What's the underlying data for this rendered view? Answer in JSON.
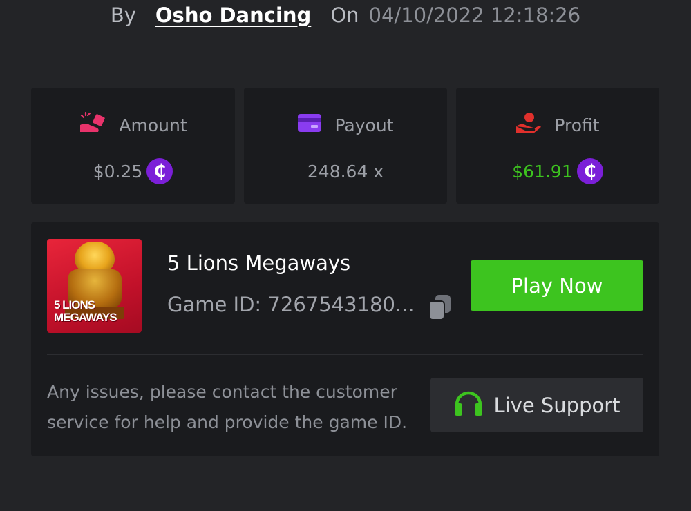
{
  "byline": {
    "by_label": "By",
    "author": "Osho Dancing",
    "on_label": "On",
    "datetime": "04/10/2022 12:18:26"
  },
  "stats": {
    "amount": {
      "label": "Amount",
      "value": "$0.25",
      "icon": "amount-hand-icon",
      "currency_icon": "coin-icon"
    },
    "payout": {
      "label": "Payout",
      "value": "248.64 x",
      "icon": "card-icon"
    },
    "profit": {
      "label": "Profit",
      "value": "$61.91",
      "icon": "profit-hand-icon",
      "currency_icon": "coin-icon"
    }
  },
  "coin_symbol": "₵",
  "game": {
    "title": "5 Lions Megaways",
    "game_id": "Game ID: 7267543180...",
    "thumbnail_line1": "5 LIONS",
    "thumbnail_line2": "MEGAWAYS",
    "play_label": "Play Now",
    "copy_icon": "copy-icon"
  },
  "support": {
    "help_text": "Any issues, please contact the customer service for help and provide the game ID.",
    "button_label": "Live Support",
    "icon": "headset-icon"
  },
  "colors": {
    "background": "#232427",
    "card": "#1a1b1e",
    "accent_green": "#3dc41f",
    "coin_purple": "#7b1fd8",
    "amount_pink": "#e8336b",
    "payout_purple": "#8a3cf0",
    "profit_red": "#e0302c"
  }
}
